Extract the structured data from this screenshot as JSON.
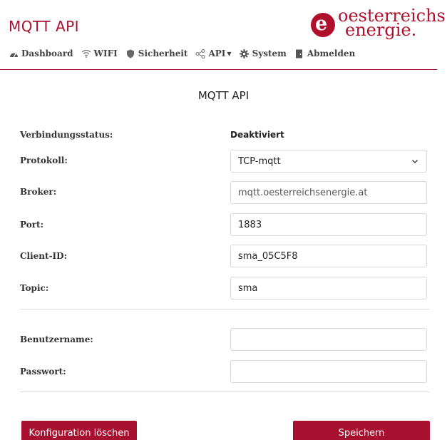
{
  "app": {
    "title": "MQTT API"
  },
  "logo": {
    "line1": "oesterreichs",
    "line2": "energie.",
    "mark": "e"
  },
  "nav": {
    "items": [
      {
        "label": "Dashboard",
        "icon": "dashboard-icon"
      },
      {
        "label": "WIFI",
        "icon": "wifi-icon"
      },
      {
        "label": "Sicherheit",
        "icon": "shield-icon"
      },
      {
        "label": "API",
        "icon": "share-icon",
        "dropdown": true
      },
      {
        "label": "System",
        "icon": "gear-icon"
      },
      {
        "label": "Abmelden",
        "icon": "door-icon"
      }
    ]
  },
  "form": {
    "title": "MQTT API",
    "status": {
      "label": "Verbindungsstatus:",
      "value": "Deaktiviert"
    },
    "protokoll": {
      "label": "Protokoll:",
      "value": "TCP-mqtt"
    },
    "broker": {
      "label": "Broker:",
      "placeholder": "mqtt.oesterreichsenergie.at"
    },
    "port": {
      "label": "Port:",
      "value": "1883"
    },
    "client_id": {
      "label": "Client-ID:",
      "value": "sma_05C5F8"
    },
    "topic": {
      "label": "Topic:",
      "value": "sma"
    },
    "username": {
      "label": "Benutzername:",
      "value": ""
    },
    "password": {
      "label": "Passwort:",
      "value": ""
    }
  },
  "buttons": {
    "delete_label": "Konfiguration löschen",
    "save_label": "Speichern"
  },
  "colors": {
    "accent": "#a8102f",
    "border": "#d8d8d8"
  }
}
